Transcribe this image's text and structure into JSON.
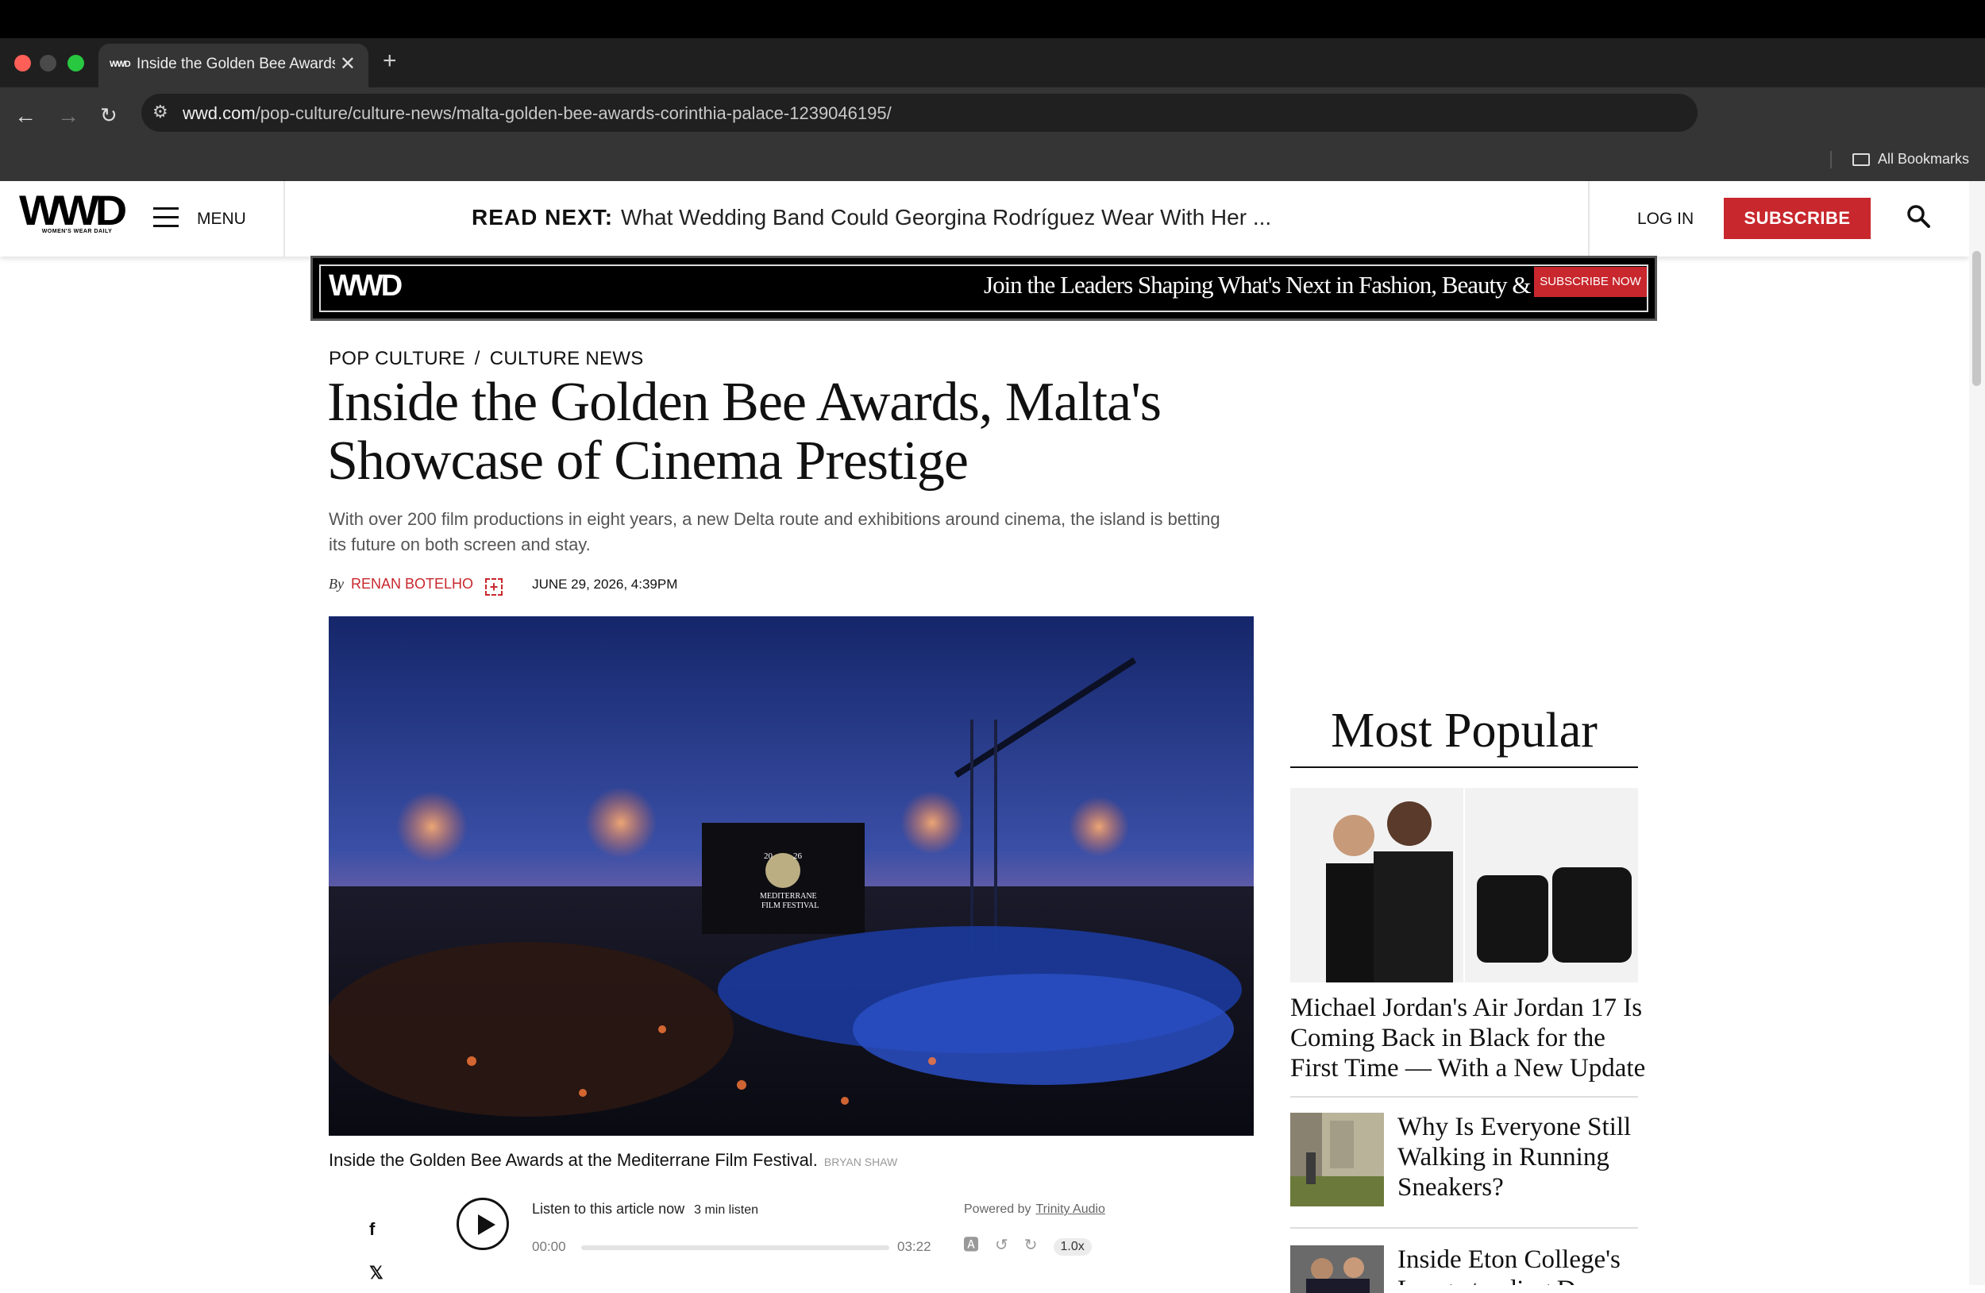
{
  "browser": {
    "tab_title": "Inside the Golden Bee Awards, Malta's",
    "tab_favicon_text": "WWD",
    "url_domain": "wwd.com",
    "url_path": "/pop-culture/culture-news/malta-golden-bee-awards-corinthia-palace-1239046195/",
    "bookmarks_label": "All Bookmarks"
  },
  "site": {
    "logo": "WWD",
    "logo_sub": "WOMEN'S WEAR DAILY",
    "menu_label": "MENU",
    "read_next_label": "READ NEXT:",
    "read_next_text": "What Wedding Band Could Georgina Rodríguez Wear With Her ...",
    "login_label": "LOG IN",
    "subscribe_label": "SUBSCRIBE"
  },
  "banner": {
    "logo": "WWD",
    "text": "Join the Leaders Shaping What's Next in Fashion, Beauty & Retail.",
    "button": "SUBSCRIBE NOW"
  },
  "article": {
    "breadcrumb_1": "POP CULTURE",
    "breadcrumb_sep": "/",
    "breadcrumb_2": "CULTURE NEWS",
    "headline": "Inside the Golden Bee Awards, Malta's Showcase of Cinema Prestige",
    "dek": "With over 200 film productions in eight years, a new Delta route and exhibitions around cinema, the island is betting its future on both screen and stay.",
    "by": "By",
    "author": "RENAN BOTELHO",
    "date": "JUNE 29, 2026, 4:39PM",
    "hero_screen_text_1": "20",
    "hero_screen_text_2": "26",
    "hero_screen_text_3": "MEDITERRANE",
    "hero_screen_text_4": "FILM FESTIVAL",
    "caption": "Inside the Golden Bee Awards at the Mediterrane Film Festival.",
    "credit": "BRYAN SHAW"
  },
  "share": {
    "facebook": "f",
    "x": "𝕏"
  },
  "audio": {
    "listen_label": "Listen to this article now",
    "duration_label": "3 min listen",
    "powered_by": "Powered by",
    "provider": "Trinity Audio",
    "time_start": "00:00",
    "time_end": "03:22",
    "speed": "1.0x",
    "progress": 0
  },
  "popular": {
    "title": "Most Popular",
    "items": [
      {
        "title": "Michael Jordan's Air Jordan 17 Is Coming Back in Black for the First Time — With a New Update"
      },
      {
        "title": "Why Is Everyone Still Walking in Running Sneakers?"
      },
      {
        "title": "Inside Eton College's Long-standing Dress Code"
      }
    ]
  },
  "colors": {
    "accent": "#c8272d",
    "chrome_dark": "#1f1f1f",
    "chrome_mid": "#353535"
  }
}
